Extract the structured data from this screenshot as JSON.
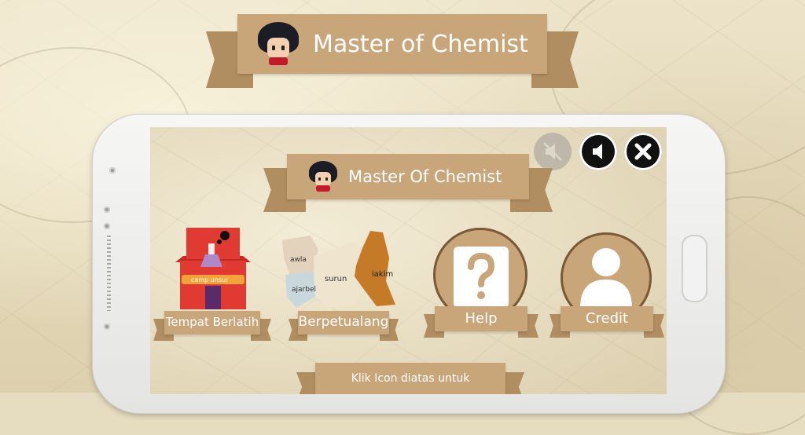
{
  "app": {
    "title": "Master of Chemist"
  },
  "screen": {
    "title": "Master Of Chemist",
    "controls": {
      "mute_icon": "speaker-muted-icon",
      "sound_icon": "speaker-icon",
      "close_icon": "close-icon"
    },
    "menu": [
      {
        "id": "training",
        "label": "Tempat Berlatih",
        "icon": "lab-house-icon",
        "sign": "camp unsur"
      },
      {
        "id": "adventure",
        "label": "Berpetualang",
        "icon": "map-icon",
        "regions": [
          "awla",
          "surun",
          "iakim",
          "ajarbel"
        ]
      },
      {
        "id": "help",
        "label": "Help",
        "icon": "question-icon"
      },
      {
        "id": "credit",
        "label": "Credit",
        "icon": "person-icon"
      }
    ],
    "footer_text": "Klik Icon diatas untuk"
  },
  "colors": {
    "ribbon": "#c9a67a",
    "ribbon_tail": "#b08e62",
    "house_red": "#e03a32",
    "region_orange": "#c47a26"
  }
}
